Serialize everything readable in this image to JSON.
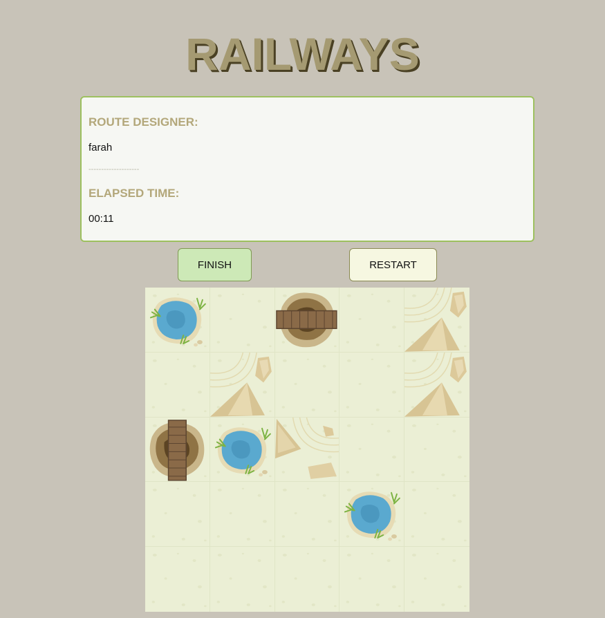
{
  "title": "RAILWAYS",
  "info": {
    "designer_label": "ROUTE DESIGNER:",
    "designer_name": "farah",
    "separator": "--------------------",
    "time_label": "ELAPSED TIME:",
    "time_value": "00:11"
  },
  "buttons": {
    "finish": "FINISH",
    "restart": "RESTART"
  },
  "board": {
    "rows": 5,
    "cols": 5,
    "cells": [
      [
        "oasis",
        "empty",
        "bridge-horizontal",
        "empty",
        "mountain"
      ],
      [
        "empty",
        "mountain",
        "empty",
        "empty",
        "mountain"
      ],
      [
        "bridge-vertical",
        "oasis",
        "mountain-rotated",
        "empty",
        "empty"
      ],
      [
        "empty",
        "empty",
        "empty",
        "oasis",
        "empty"
      ],
      [
        "empty",
        "empty",
        "empty",
        "empty",
        "empty"
      ]
    ]
  },
  "colors": {
    "background": "#c8c3b8",
    "title": "#a59a72",
    "panel_border": "#9dc05f",
    "label": "#b3a77a",
    "finish_button": "#cde9b7",
    "restart_button": "#f6f7e1",
    "board": "#ebefd5",
    "water": "#5aa9cf"
  }
}
